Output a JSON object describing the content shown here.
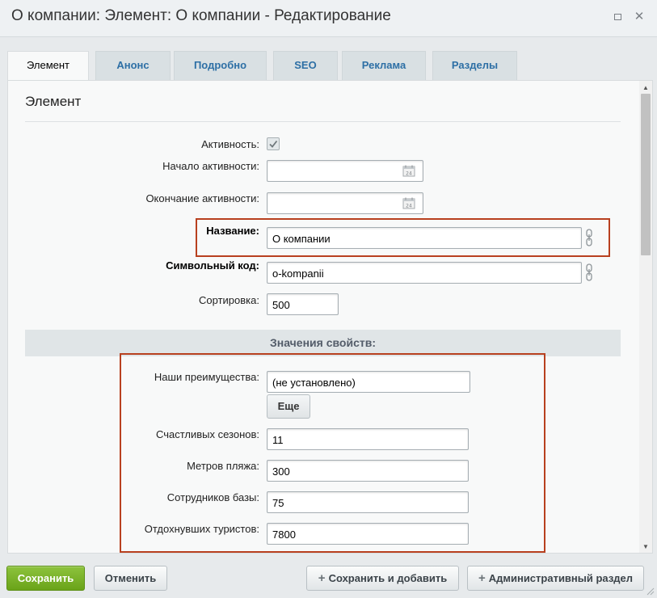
{
  "window": {
    "title": "О компании: Элемент: О компании - Редактирование",
    "maximize_icon": "maximize-icon",
    "close_icon": "close-icon",
    "close_glyph": "✕"
  },
  "tabs": [
    {
      "label": "Элемент",
      "active": true
    },
    {
      "label": "Анонс",
      "active": false
    },
    {
      "label": "Подробно",
      "active": false
    },
    {
      "label": "SEO",
      "active": false
    },
    {
      "label": "Реклама",
      "active": false
    },
    {
      "label": "Разделы",
      "active": false
    }
  ],
  "section": {
    "title": "Элемент"
  },
  "fields": {
    "active": {
      "label": "Активность:",
      "checked": true
    },
    "active_from": {
      "label": "Начало активности:",
      "value": "",
      "icon": "calendar-icon"
    },
    "active_to": {
      "label": "Окончание активности:",
      "value": "",
      "icon": "calendar-icon"
    },
    "name": {
      "label": "Название:",
      "value": "О компании",
      "icon": "link-icon"
    },
    "code": {
      "label": "Символьный код:",
      "value": "o-kompanii",
      "icon": "link-icon"
    },
    "sort": {
      "label": "Сортировка:",
      "value": "500"
    }
  },
  "properties": {
    "header": "Значения свойств:",
    "advantages": {
      "label": "Наши преимущества:",
      "value": "(не установлено)",
      "more_label": "Еще"
    },
    "seasons": {
      "label": "Счастливых сезонов:",
      "value": "11"
    },
    "beach": {
      "label": "Метров пляжа:",
      "value": "300"
    },
    "staff": {
      "label": "Сотрудников базы:",
      "value": "75"
    },
    "tourists": {
      "label": "Отдохнувших туристов:",
      "value": "7800"
    }
  },
  "footer": {
    "save": "Сохранить",
    "cancel": "Отменить",
    "save_add": "Сохранить и добавить",
    "admin": "Административный раздел",
    "plus_glyph": "+"
  },
  "colors": {
    "save_green": "#7ab12a",
    "highlight_red": "#b8401f",
    "tab_link": "#2d6fa5"
  }
}
